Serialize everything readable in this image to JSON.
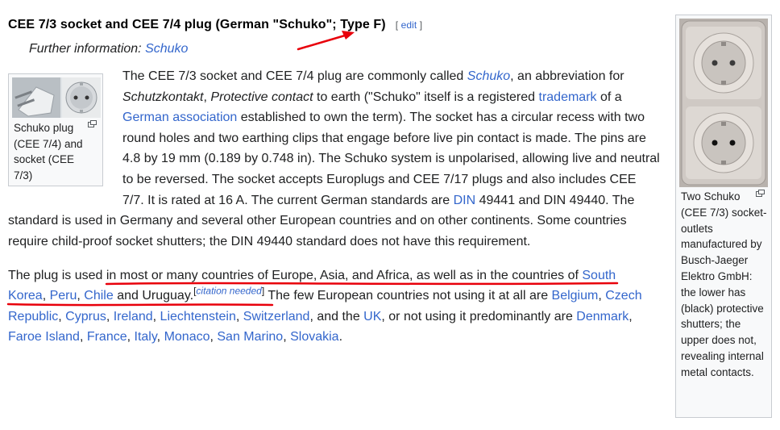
{
  "heading": {
    "title": "CEE 7/3 socket and CEE 7/4 plug (German \"Schuko\"; Type F)",
    "edit_open": "[",
    "edit_label": "edit",
    "edit_close": "]"
  },
  "hatnote": {
    "prefix": "Further information: ",
    "link": "Schuko"
  },
  "thumb_left": {
    "caption": "Schuko plug (CEE 7/4) and socket (CEE 7/3)",
    "icon": "magnify-icon"
  },
  "thumb_right": {
    "caption": "Two Schuko (CEE 7/3) socket-outlets manufactured by Busch-Jaeger Elektro GmbH: the lower has (black) protective shutters; the upper does not, revealing internal metal contacts.",
    "icon": "magnify-icon"
  },
  "para1": {
    "t1": "The CEE 7/3 socket and CEE 7/4 plug are commonly called ",
    "l1": "Schuko",
    "t2": ", an abbreviation for ",
    "i1": "Schutzkontakt",
    "t3": ", ",
    "i2": "Protective contact",
    "t4": " to earth (\"Schuko\" itself is a registered ",
    "l2": "trademark",
    "t5": " of a ",
    "l3": "German association",
    "t6": " established to own the term). The socket has a circular recess with two round holes and two earthing clips that engage before live pin contact is made. The pins are 4.8 by 19 mm (0.189 by 0.748 in). The Schuko system is unpolarised, allowing live and neutral to be reversed. The socket accepts Europlugs and CEE 7/17 plugs and also includes CEE 7/7. It is rated at 16 A. The current German standards are ",
    "l4": "DIN",
    "t7": " 49441 and DIN 49440. The standard is used in Germany and several other European countries and on other continents. Some countries require child-proof socket shutters; the DIN 49440 standard does not have this requirement."
  },
  "para2": {
    "t1": "The plug is used in most or many countries of Europe, Asia, and Africa, as well as in the countries of ",
    "l_south_korea": "South Korea",
    "c1": ", ",
    "l_peru": "Peru",
    "c2": ", ",
    "l_chile": "Chile",
    "t2": " and Uruguay.",
    "cn_open": "[",
    "cn_label": "citation needed",
    "cn_close": "]",
    "t3": " The few European countries not using it at all are ",
    "l_belgium": "Belgium",
    "c3": ", ",
    "l_czech": "Czech Republic",
    "c4": ", ",
    "l_cyprus": "Cyprus",
    "c5": ", ",
    "l_ireland": "Ireland",
    "c6": ", ",
    "l_liechtenstein": "Liechtenstein",
    "c7": ", ",
    "l_switzerland": "Switzerland",
    "t4": ", and the ",
    "l_uk": "UK",
    "t5": ", or not using it predominantly are ",
    "l_denmark": "Denmark",
    "c8": ", ",
    "l_faroe": "Faroe Island",
    "c9": ", ",
    "l_france": "France",
    "c10": ", ",
    "l_italy": "Italy",
    "c11": ", ",
    "l_monaco": "Monaco",
    "c12": ", ",
    "l_sanmarino": "San Marino",
    "c13": ", ",
    "l_slovakia": "Slovakia",
    "t6": "."
  },
  "annotations": {
    "color": "#e8000b",
    "arrow": "red-arrow",
    "underline": "red-underline"
  }
}
